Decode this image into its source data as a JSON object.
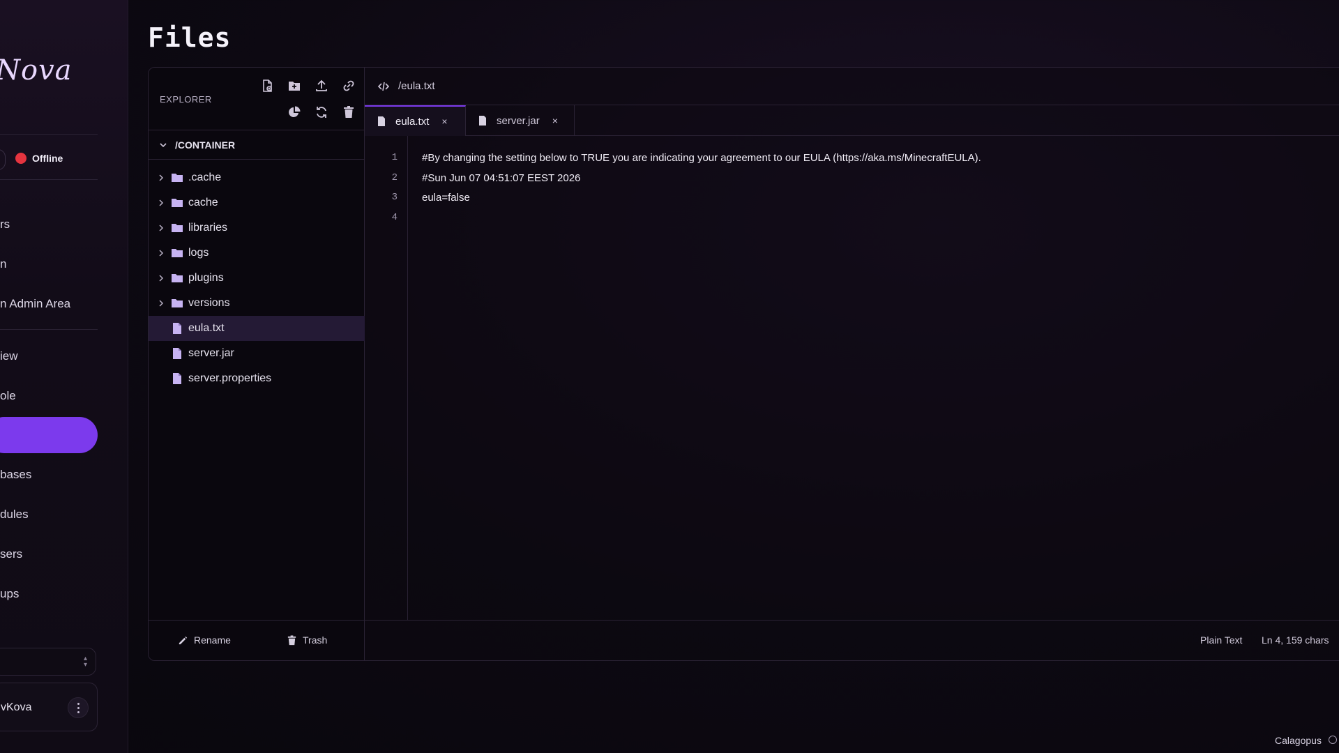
{
  "sidebar": {
    "brand": "Nova",
    "server_status": "Offline",
    "nav_items": [
      {
        "label": "rs"
      },
      {
        "label": "n"
      },
      {
        "label": "n Admin Area"
      },
      {
        "label": "iew"
      },
      {
        "label": "ole"
      },
      {
        "label": ""
      },
      {
        "label": "bases"
      },
      {
        "label": "dules"
      },
      {
        "label": "sers"
      },
      {
        "label": "ups"
      }
    ],
    "user_name": "vKova"
  },
  "page": {
    "title": "Files"
  },
  "explorer": {
    "title": "EXPLORER",
    "root": "/CONTAINER",
    "folders": [
      ".cache",
      "cache",
      "libraries",
      "logs",
      "plugins",
      "versions"
    ],
    "files": [
      "eula.txt",
      "server.jar",
      "server.properties"
    ],
    "selected": "eula.txt",
    "footer": {
      "rename": "Rename",
      "trash": "Trash"
    }
  },
  "editor": {
    "path": "/eula.txt",
    "tabs": [
      {
        "label": "eula.txt",
        "active": true
      },
      {
        "label": "server.jar",
        "active": false
      }
    ],
    "close_glyph": "×",
    "lines": [
      "#By changing the setting below to TRUE you are indicating your agreement to our EULA (https://aka.ms/MinecraftEULA).",
      "#Sun Jun 07 04:51:07 EEST 2026",
      "eula=false",
      ""
    ],
    "line_numbers": [
      "1",
      "2",
      "3",
      "4"
    ],
    "status": {
      "language": "Plain Text",
      "position": "Ln 4, 159 chars"
    }
  },
  "footer": {
    "brand": "Calagopus"
  },
  "colors": {
    "accent": "#7c3aed",
    "offline": "#e5343f",
    "selected_row": "#241a35"
  }
}
